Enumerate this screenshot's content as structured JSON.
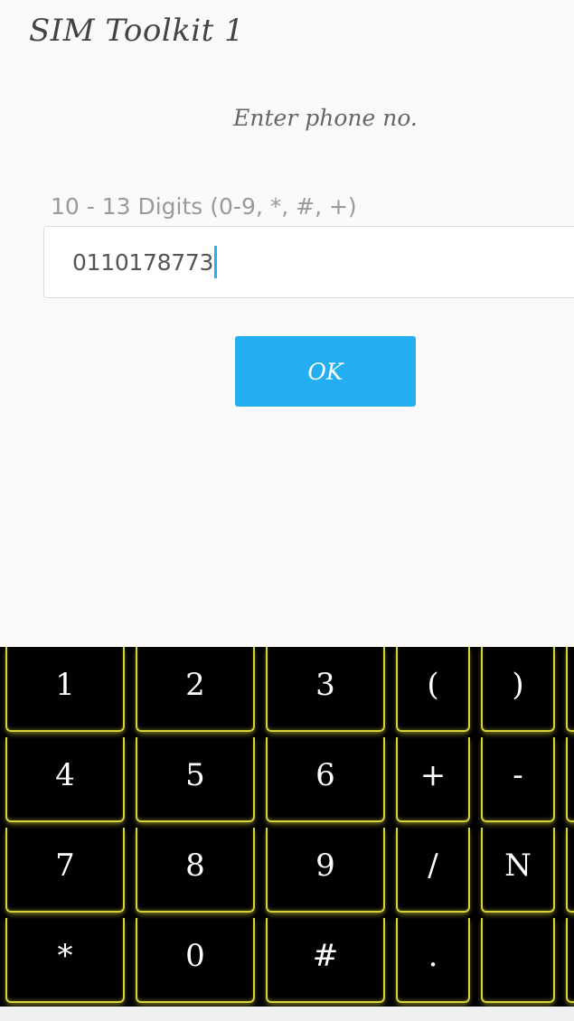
{
  "header": {
    "title": "SIM Toolkit 1"
  },
  "form": {
    "prompt": "Enter phone no.",
    "hint": "10 - 13 Digits (0-9, *, #, +)",
    "value": "0110178773",
    "ok_label": "OK"
  },
  "keyboard": {
    "rows": [
      [
        "1",
        "2",
        "3",
        "(",
        ")"
      ],
      [
        "4",
        "5",
        "6",
        "+",
        "-"
      ],
      [
        "7",
        "8",
        "9",
        "/",
        "N"
      ],
      [
        "*",
        "0",
        "#",
        ".",
        ""
      ]
    ],
    "key_color": "#d8d23a"
  }
}
